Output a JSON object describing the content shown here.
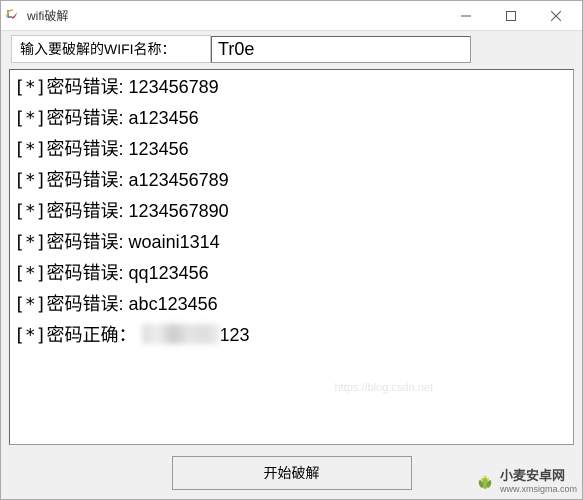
{
  "window": {
    "title": "wifi破解"
  },
  "input": {
    "label": "输入要破解的WIFI名称：",
    "value": "Tr0e"
  },
  "output": {
    "lines": [
      {
        "prefix": "[*]",
        "label": "密码错误:",
        "value": "123456789"
      },
      {
        "prefix": "[*]",
        "label": "密码错误:",
        "value": "a123456"
      },
      {
        "prefix": "[*]",
        "label": "密码错误:",
        "value": "123456"
      },
      {
        "prefix": "[*]",
        "label": "密码错误:",
        "value": "a123456789"
      },
      {
        "prefix": "[*]",
        "label": "密码错误:",
        "value": "1234567890"
      },
      {
        "prefix": "[*]",
        "label": "密码错误:",
        "value": "woaini1314"
      },
      {
        "prefix": "[*]",
        "label": "密码错误:",
        "value": "qq123456"
      },
      {
        "prefix": "[*]",
        "label": "密码错误:",
        "value": "abc123456"
      }
    ],
    "correct": {
      "prefix": "[*]",
      "label": "密码正确：",
      "hidden_suffix": "123"
    }
  },
  "button": {
    "start_label": "开始破解"
  },
  "watermark": {
    "text": "小麦安卓网",
    "url": "www.xmsigma.com"
  }
}
